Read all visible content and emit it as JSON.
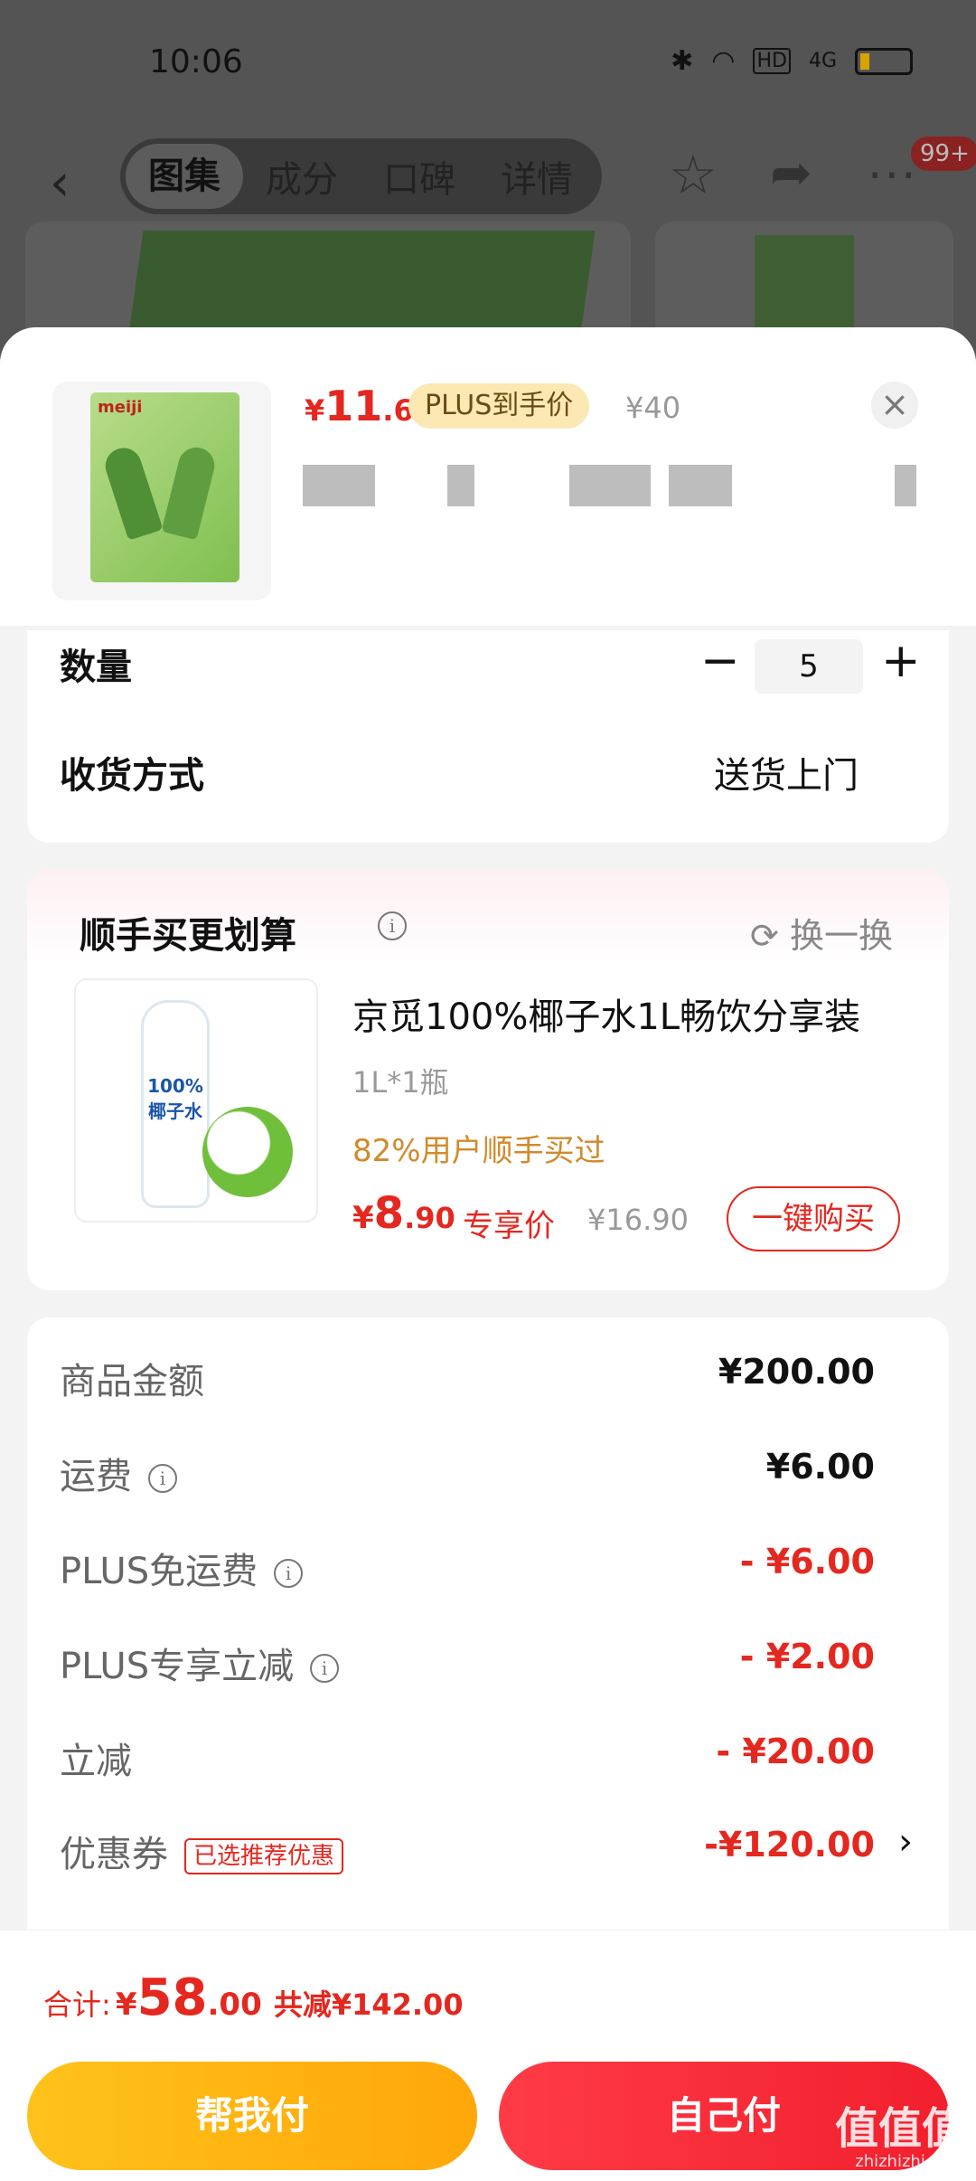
{
  "status_bar": {
    "time": "10:06",
    "signal_text": "4G",
    "hd": "HD"
  },
  "nav": {
    "tabs": [
      "图集",
      "成分",
      "口碑",
      "详情"
    ],
    "active_tab": 0,
    "badge": "99+"
  },
  "product": {
    "price_currency": "¥",
    "price_int": "11",
    "price_dec": ".6",
    "plus_tag": "PLUS到手价",
    "original_price": "¥40",
    "brand": "meiji"
  },
  "quantity": {
    "label": "数量",
    "value": "5",
    "minus": "−",
    "plus": "+"
  },
  "delivery": {
    "label": "收货方式",
    "value": "送货上门"
  },
  "addon": {
    "title": "顺手买更划算",
    "refresh_label": "换一换",
    "name": "京觅100%椰子水1L畅饮分享装",
    "spec": "1L*1瓶",
    "social_proof": "82%用户顺手买过",
    "price_currency": "¥",
    "price_int": "8",
    "price_dec": ".90",
    "price_tag": "专享价",
    "original_price": "¥16.90",
    "buy_label": "一键购买",
    "bottle_label": "100% 椰子水"
  },
  "summary": {
    "rows": [
      {
        "label": "商品金额",
        "value": "¥200.00",
        "info": false,
        "red": false
      },
      {
        "label": "运费",
        "value": "¥6.00",
        "info": true,
        "red": false
      },
      {
        "label": "PLUS免运费",
        "value": "- ¥6.00",
        "info": true,
        "red": true
      },
      {
        "label": "PLUS专享立减",
        "value": "- ¥2.00",
        "info": true,
        "red": true
      },
      {
        "label": "立减",
        "value": "- ¥20.00",
        "info": false,
        "red": true
      },
      {
        "label": "优惠券",
        "value": "-¥120.00",
        "info": false,
        "red": true,
        "tag": "已选推荐优惠"
      }
    ]
  },
  "footer": {
    "total_label": "合计:",
    "total_currency": "¥",
    "total_int": "58",
    "total_dec": ".00",
    "saved": "共减¥142.00",
    "help_pay": "帮我付",
    "self_pay": "自己付"
  },
  "watermark": {
    "text": "值值值",
    "site": "zhizhizhi.com"
  },
  "colors": {
    "accent_red": "#e4271f",
    "gold": "#ffb20f",
    "plus_bg": "#fbe8b3"
  }
}
